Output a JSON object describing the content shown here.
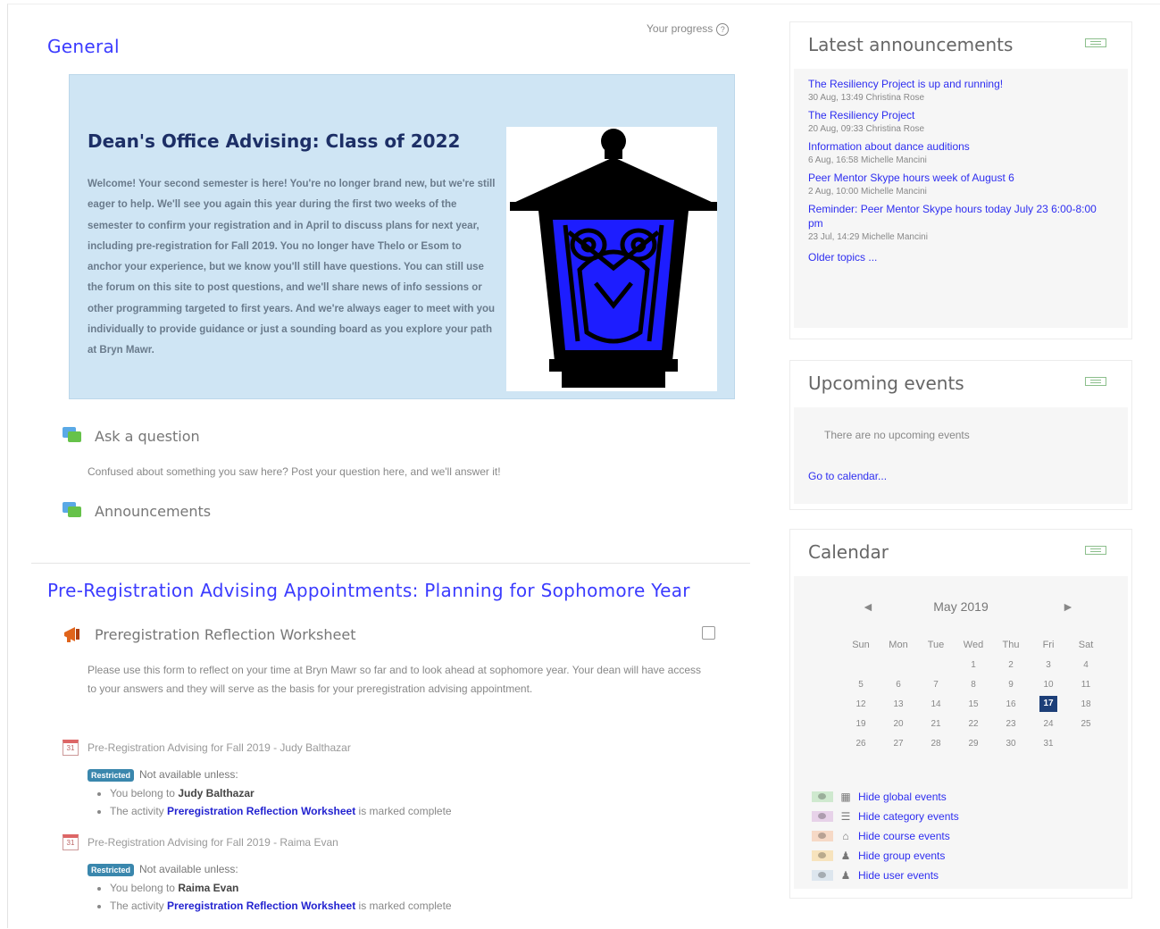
{
  "progress": {
    "label": "Your progress",
    "help_icon": "question-circle-icon"
  },
  "sections": {
    "general": {
      "title": "General"
    },
    "prereg": {
      "title": "Pre-Registration Advising Appointments: Planning for Sophomore Year"
    }
  },
  "banner": {
    "heading": "Dean's Office Advising: Class of 2022",
    "body": "Welcome! Your second semester is here! You're no longer brand new, but we're still eager to help. We'll see you again this year during the first two weeks of the semester to confirm your registration and in April to discuss plans for next year, including pre-registration for Fall 2019. You no longer have Thelo or Esom to anchor your experience, but we know you'll still have questions. You can still use the forum on this site to post questions, and we'll share news of info sessions or other programming targeted to first years. And we're always eager to meet with you individually to provide guidance or just a sounding board as you explore your path at Bryn Mawr.",
    "image": "owl-lantern-icon",
    "colors": {
      "lantern_body": "#000000",
      "lantern_glass": "#1d1dff"
    }
  },
  "activities": {
    "ask": {
      "label": "Ask a question",
      "desc": "Confused about something you saw here? Post your question here, and we'll answer it!",
      "icon": "forum-icon"
    },
    "announcements": {
      "label": "Announcements",
      "icon": "forum-icon"
    },
    "worksheet": {
      "label": "Preregistration Reflection Worksheet",
      "desc": "Please use this form to reflect on your time at Bryn Mawr so far and to look ahead at sophomore year. Your dean will have access to your answers and they will serve as the basis for your preregistration advising appointment.",
      "icon": "feedback-icon"
    }
  },
  "schedulers": [
    {
      "label": "Pre-Registration Advising for Fall 2019 - Judy Balthazar",
      "badge": "Restricted",
      "not_available": "Not available unless:",
      "cond1_prefix": "You belong to",
      "cond1_name": "Judy Balthazar",
      "cond2_prefix": "The activity",
      "cond2_link": "Preregistration Reflection Worksheet",
      "cond2_suffix": "is marked complete"
    },
    {
      "label": "Pre-Registration Advising for Fall 2019 - Raima Evan",
      "badge": "Restricted",
      "not_available": "Not available unless:",
      "cond1_prefix": "You belong to",
      "cond1_name": "Raima Evan",
      "cond2_prefix": "The activity",
      "cond2_link": "Preregistration Reflection Worksheet",
      "cond2_suffix": "is marked complete"
    }
  ],
  "latest_announcements": {
    "title": "Latest announcements",
    "items": [
      {
        "title": "The Resiliency Project is up and running!",
        "meta": "30 Aug, 13:49 Christina Rose"
      },
      {
        "title": "The Resiliency Project",
        "meta": "20 Aug, 09:33 Christina Rose"
      },
      {
        "title": "Information about dance auditions",
        "meta": "6 Aug, 16:58 Michelle Mancini"
      },
      {
        "title": "Peer Mentor Skype hours week of August 6",
        "meta": "2 Aug, 10:00 Michelle Mancini"
      },
      {
        "title": "Reminder: Peer Mentor Skype hours today July 23 6:00-8:00 pm",
        "meta": "23 Jul, 14:29 Michelle Mancini"
      }
    ],
    "older": "Older topics ..."
  },
  "upcoming": {
    "title": "Upcoming events",
    "empty": "There are no upcoming events",
    "go": "Go to calendar..."
  },
  "calendar": {
    "title": "Calendar",
    "month": "May 2019",
    "prev": "◄",
    "next": "►",
    "weekdays": [
      "Sun",
      "Mon",
      "Tue",
      "Wed",
      "Thu",
      "Fri",
      "Sat"
    ],
    "weeks": [
      [
        "",
        "",
        "",
        "1",
        "2",
        "3",
        "4"
      ],
      [
        "5",
        "6",
        "7",
        "8",
        "9",
        "10",
        "11"
      ],
      [
        "12",
        "13",
        "14",
        "15",
        "16",
        "17",
        "18"
      ],
      [
        "19",
        "20",
        "21",
        "22",
        "23",
        "24",
        "25"
      ],
      [
        "26",
        "27",
        "28",
        "29",
        "30",
        "31",
        ""
      ]
    ],
    "today": "17",
    "filters": [
      {
        "label": "Hide global events",
        "color": "#cfe9cf",
        "icon": "calendar-icon"
      },
      {
        "label": "Hide category events",
        "color": "#e7d2e9",
        "icon": "category-icon"
      },
      {
        "label": "Hide course events",
        "color": "#f6d9c6",
        "icon": "course-icon"
      },
      {
        "label": "Hide group events",
        "color": "#f7e3bd",
        "icon": "group-icon"
      },
      {
        "label": "Hide user events",
        "color": "#dde6ee",
        "icon": "user-icon"
      }
    ]
  }
}
